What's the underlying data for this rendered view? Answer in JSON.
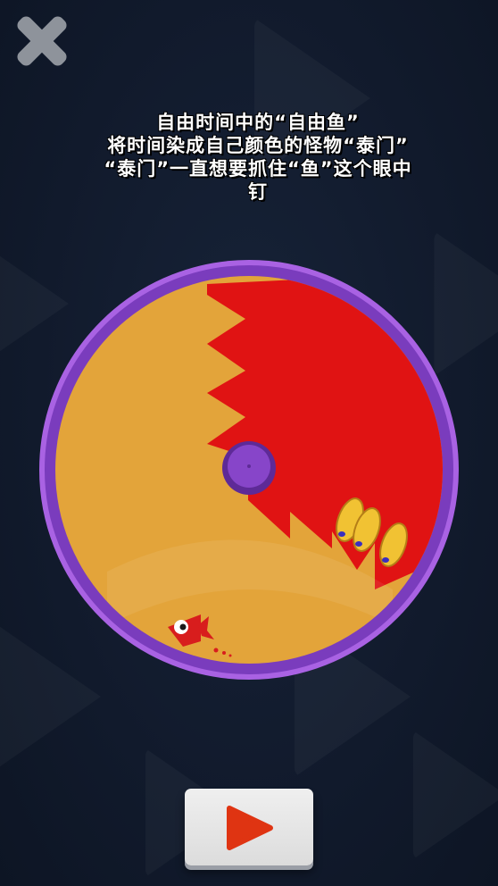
{
  "story": {
    "lines": [
      "自由时间中的“自由鱼”",
      "将时间染成自己颜色的怪物“泰门”",
      "“泰门”一直想要抓住“鱼”这个眼中",
      "钉"
    ]
  },
  "controls": {
    "close_icon": "close-x-icon",
    "play_icon": "play-triangle-icon"
  },
  "colors": {
    "background": "#111a2c",
    "ring": "#7d3fc0",
    "free_territory": "#e3a43a",
    "monster_territory": "#e01313",
    "hub": "#7a3bb8",
    "play_triangle": "#df3412",
    "button_face": "#e8e8e8"
  },
  "game": {
    "fish": "red-fish",
    "monster_eggs": 3,
    "red_territory_fraction": 0.48
  }
}
